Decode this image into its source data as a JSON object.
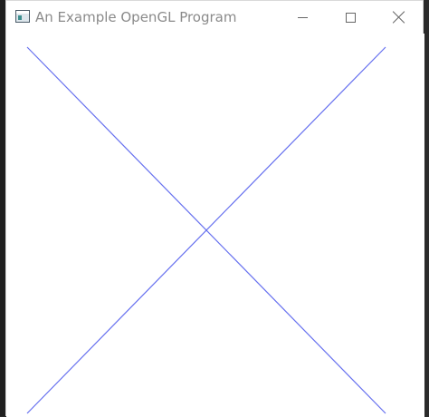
{
  "window": {
    "title": "An Example OpenGL Program"
  },
  "controls": {
    "minimize_icon": "minimize-icon",
    "maximize_icon": "maximize-icon",
    "close_icon": "close-icon"
  },
  "canvas": {
    "background_color": "#ffffff",
    "line_color": "#6670ef"
  }
}
